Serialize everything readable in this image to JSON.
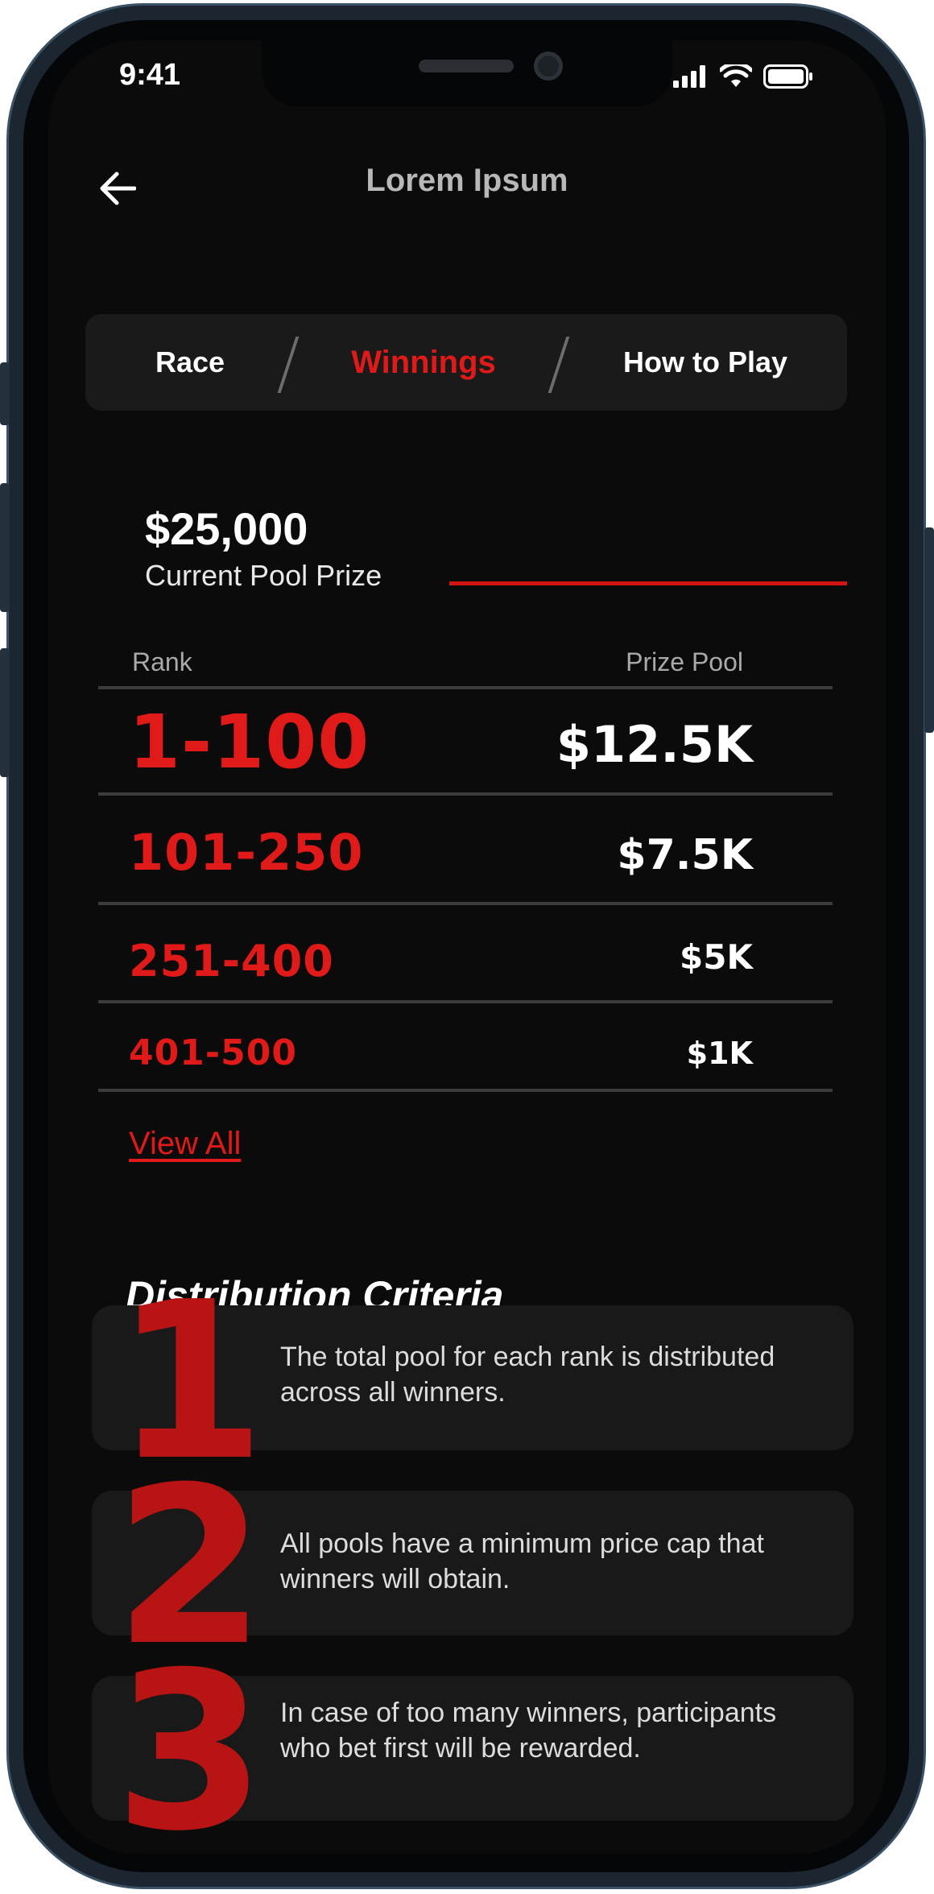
{
  "status_bar": {
    "time": "9:41"
  },
  "header": {
    "title": "Lorem Ipsum"
  },
  "tabs": [
    {
      "label": "Race",
      "active": false
    },
    {
      "label": "Winnings",
      "active": true
    },
    {
      "label": "How to Play",
      "active": false
    }
  ],
  "pool": {
    "amount": "$25,000",
    "label": "Current Pool Prize"
  },
  "table": {
    "rank_header": "Rank",
    "prize_header": "Prize Pool",
    "rows": [
      {
        "rank": "1-100",
        "prize": "$12.5K"
      },
      {
        "rank": "101-250",
        "prize": "$7.5K"
      },
      {
        "rank": "251-400",
        "prize": "$5K"
      },
      {
        "rank": "401-500",
        "prize": "$1K"
      }
    ]
  },
  "view_all": "View All",
  "distribution": {
    "title": "Distribution Criteria",
    "items": [
      {
        "number": "1",
        "text": "The total pool for each rank is distributed across all winners."
      },
      {
        "number": "2",
        "text": "All pools have a minimum price cap that winners will obtain."
      },
      {
        "number": "3",
        "text": "In case of too many winners, participants who bet first will be rewarded."
      }
    ]
  },
  "colors": {
    "accent": "#e01919",
    "background": "#0b0b0b",
    "card": "#191919",
    "number": "#b81414"
  }
}
